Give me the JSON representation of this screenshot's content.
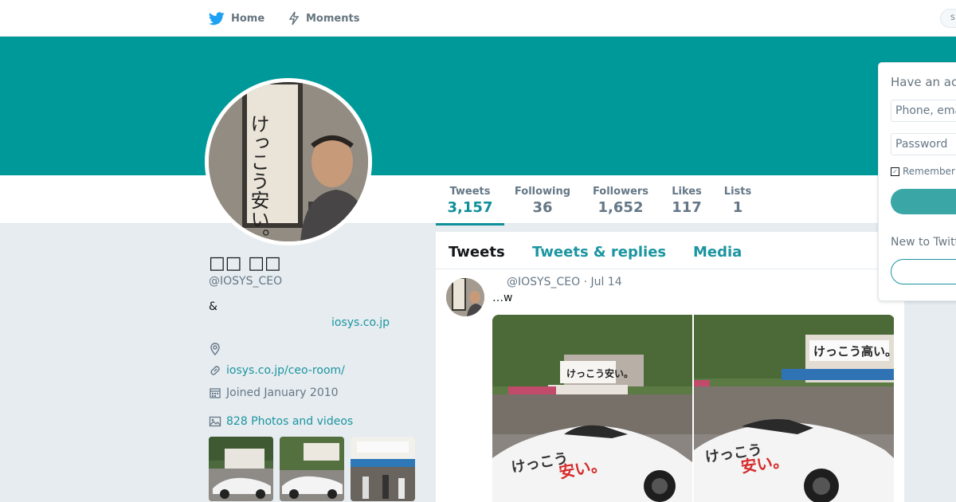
{
  "nav": {
    "home_label": "Home",
    "moments_label": "Moments",
    "search_placeholder": "S"
  },
  "colors": {
    "banner": "#009999",
    "accent": "#1b95a0",
    "background": "#e6ecf0"
  },
  "stats": [
    {
      "label": "Tweets",
      "value": "3,157"
    },
    {
      "label": "Following",
      "value": "36"
    },
    {
      "label": "Followers",
      "value": "1,652"
    },
    {
      "label": "Likes",
      "value": "117"
    },
    {
      "label": "Lists",
      "value": "1"
    }
  ],
  "profile": {
    "name": "□□ □□",
    "handle": "@IOSYS_CEO",
    "bio_line1": "&",
    "bio_link": "iosys.co.jp",
    "url": "iosys.co.jp/ceo-room/",
    "joined": "Joined January 2010",
    "photos": "828 Photos and videos"
  },
  "timeline": {
    "tabs": [
      "Tweets",
      "Tweets & replies",
      "Media"
    ],
    "tweet": {
      "header": "@IOSYS_CEO · Jul 14",
      "text": "…w"
    }
  },
  "login": {
    "heading": "Have an acc",
    "phone_placeholder": "Phone, ema",
    "password_placeholder": "Password",
    "remember": "Remember",
    "new_to": "New to Twitt"
  },
  "images": {
    "avatar_sign_text": "けっこう安い。",
    "store_sign_cheap": "けっこう安い。",
    "store_sign_high": "けっこう高い。"
  }
}
